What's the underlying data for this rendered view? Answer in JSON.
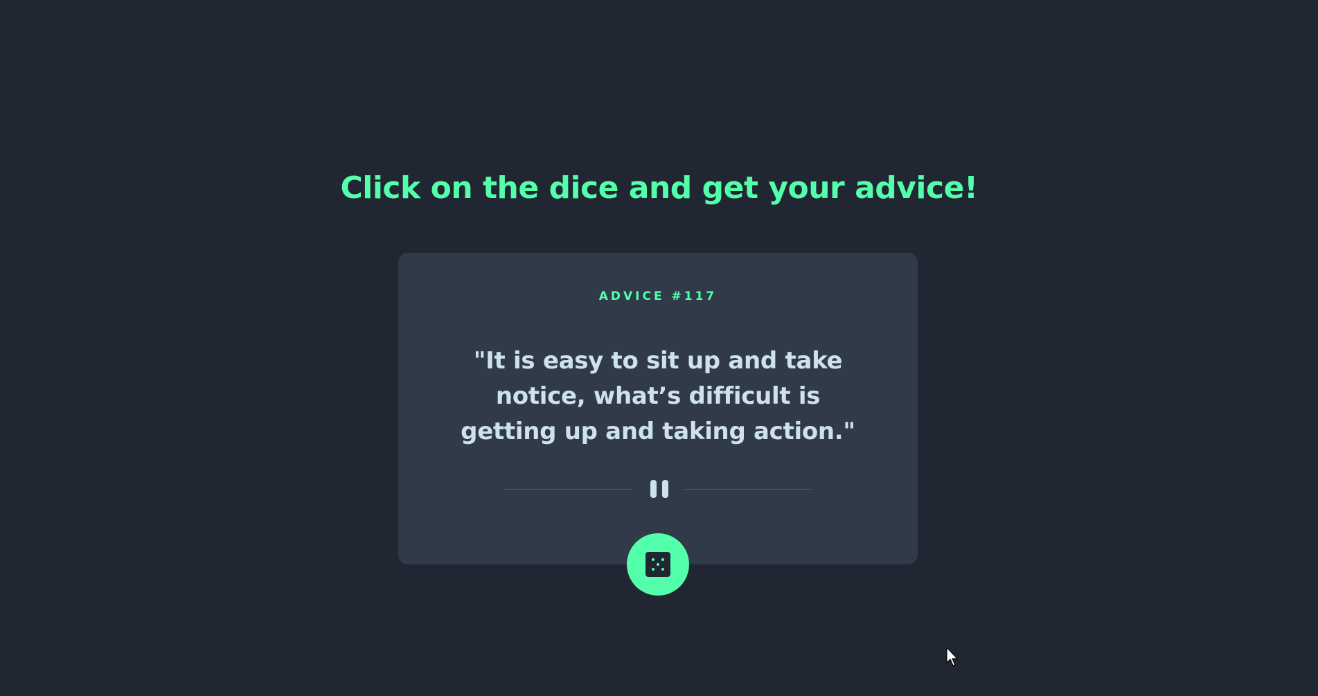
{
  "header": {
    "headline": "Click on the dice and get your advice!"
  },
  "card": {
    "advice_label": "ADVICE #117",
    "quote": "\"It is easy to sit up and take notice, what’s difficult is getting up and taking action.\""
  },
  "dice_button": {
    "icon": "dice-icon",
    "color": "#53FFAA"
  },
  "divider": {
    "icon": "pause-icon"
  },
  "colors": {
    "background": "#202632",
    "card": "#313A49",
    "accent": "#53FFAA",
    "text": "#CEE3E9",
    "divider": "#4F5D74"
  }
}
